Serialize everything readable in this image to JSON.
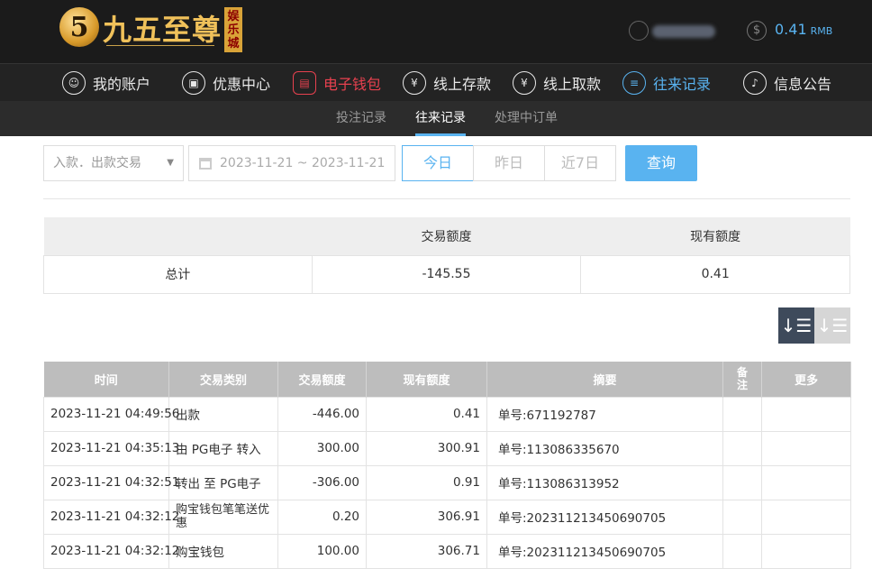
{
  "header": {
    "logo_digit": "5",
    "logo_text": "九五至尊",
    "logo_sub": "娱乐城",
    "balance_value": "0.41",
    "balance_unit": "RMB"
  },
  "nav": {
    "items": [
      {
        "label": "我的账户"
      },
      {
        "label": "优惠中心"
      },
      {
        "label": "电子钱包"
      },
      {
        "label": "线上存款"
      },
      {
        "label": "线上取款"
      },
      {
        "label": "往来记录"
      },
      {
        "label": "信息公告"
      }
    ]
  },
  "subnav": {
    "items": [
      {
        "label": "投注记录"
      },
      {
        "label": "往来记录"
      },
      {
        "label": "处理中订单"
      }
    ]
  },
  "filters": {
    "type_select": "入款．出款交易",
    "date_range": "2023-11-21 ~ 2023-11-21",
    "today": "今日",
    "yesterday": "昨日",
    "last7": "近7日",
    "query": "查询"
  },
  "summary": {
    "headers": [
      "",
      "交易额度",
      "现有额度"
    ],
    "row": [
      "总计",
      "-145.55",
      "0.41"
    ]
  },
  "table": {
    "headers": [
      "时间",
      "交易类别",
      "交易额度",
      "现有额度",
      "摘要",
      "备注",
      "更多"
    ],
    "rows": [
      [
        "2023-11-21 04:49:56",
        "出款",
        "-446.00",
        "0.41",
        "单号:671192787",
        "",
        ""
      ],
      [
        "2023-11-21 04:35:13",
        "由 PG电子 转入",
        "300.00",
        "300.91",
        "单号:113086335670",
        "",
        ""
      ],
      [
        "2023-11-21 04:32:51",
        "转出 至 PG电子",
        "-306.00",
        "0.91",
        "单号:113086313952",
        "",
        ""
      ],
      [
        "2023-11-21 04:32:12",
        "购宝钱包笔笔送优惠",
        "0.20",
        "306.91",
        "单号:202311213450690705",
        "",
        ""
      ],
      [
        "2023-11-21 04:32:12",
        "购宝钱包",
        "100.00",
        "306.71",
        "单号:202311213450690705",
        "",
        ""
      ]
    ]
  },
  "colors": {
    "accent": "#59b3f0",
    "active_red": "#e8414f",
    "header_bg": "#1b1b1b"
  }
}
